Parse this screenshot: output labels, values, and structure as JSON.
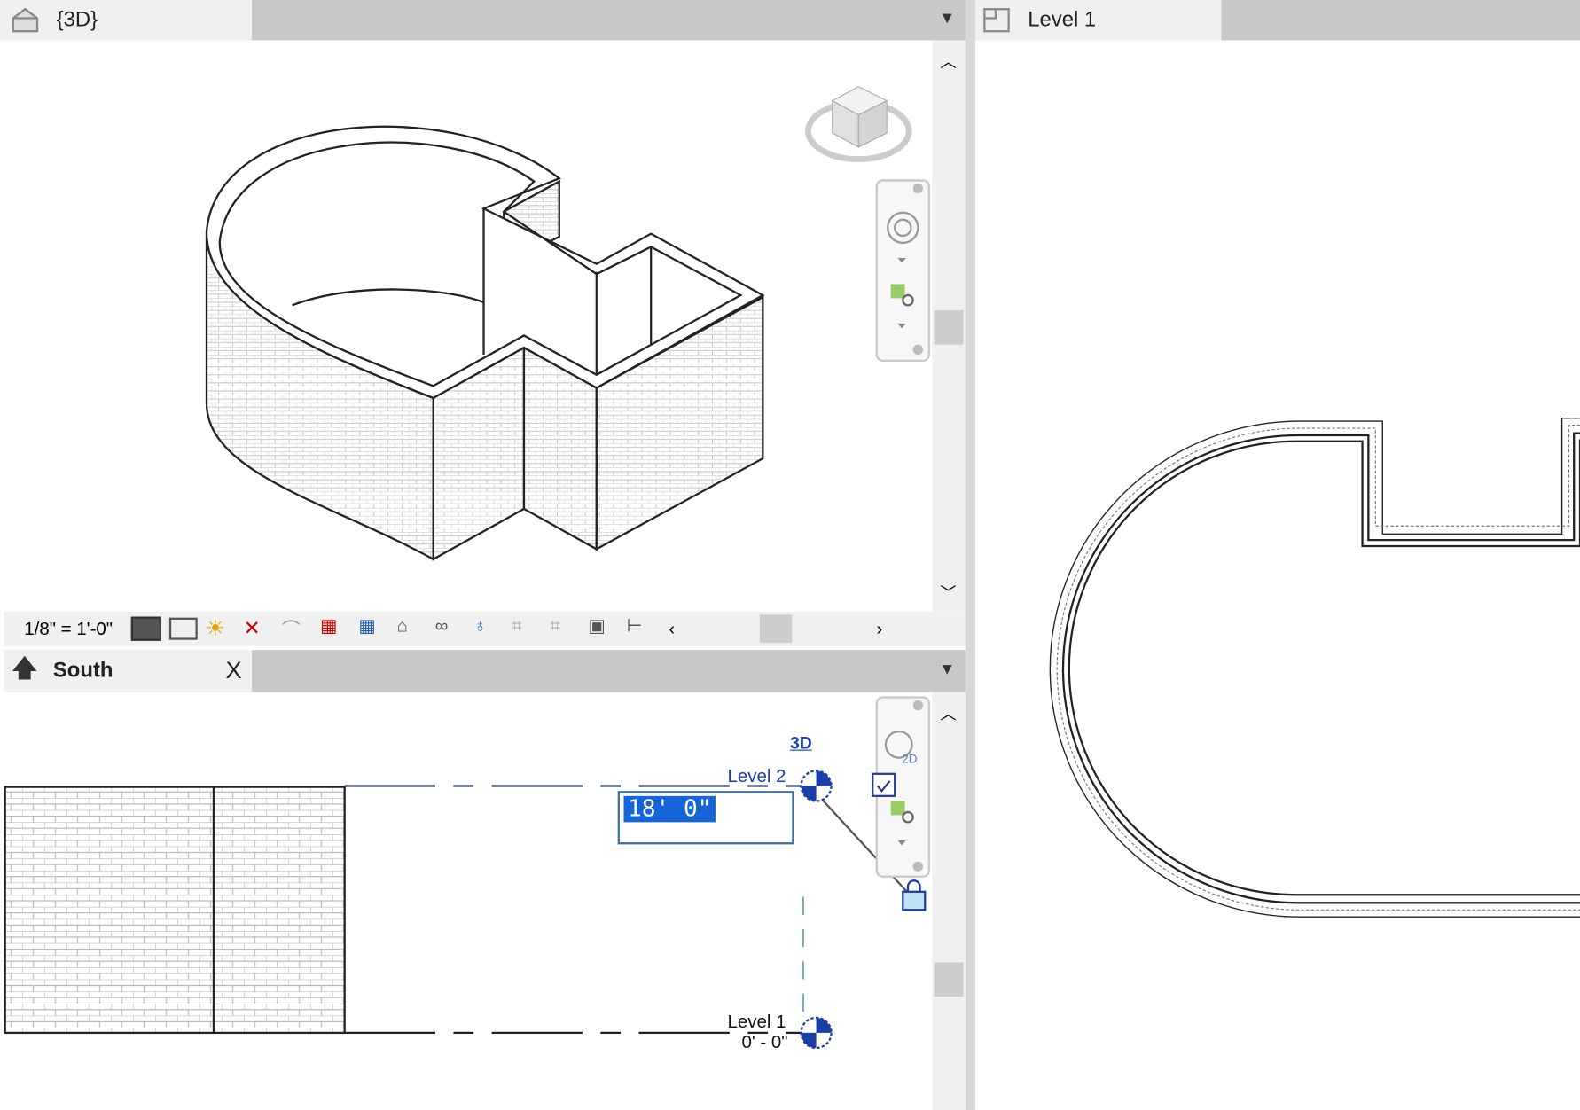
{
  "view_3d": {
    "tab_label": "{3D}",
    "scale": "1/8\" = 1'-0\"",
    "icon": "3d-house-icon"
  },
  "view_plan": {
    "tab_label": "Level 1",
    "icon": "floor-plan-icon"
  },
  "view_south": {
    "tab_label": "South",
    "close_label": "X",
    "icon": "elevation-arrow-icon",
    "link_3d": "3D",
    "level2_label": "Level 2",
    "level1_label": "Level 1",
    "level1_elevation": "0' - 0\"",
    "edit_value": "18' 0\""
  },
  "colors": {
    "accent": "#1a5fd1",
    "tabbar": "#c8c8c8",
    "select": "#1565d8"
  }
}
